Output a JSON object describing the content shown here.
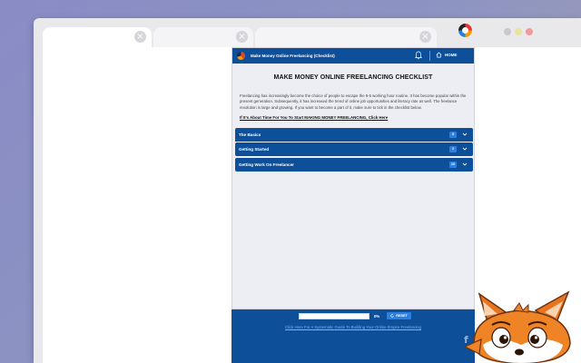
{
  "browser": {
    "tabs": [
      {
        "close_glyph": "×"
      },
      {
        "close_glyph": "×"
      },
      {
        "close_glyph": "×"
      }
    ],
    "extension_icon": "colored-ring-icon",
    "window_controls": [
      "minimize-dot",
      "maximize-dot",
      "close-dot"
    ]
  },
  "extension": {
    "header": {
      "title": "Make Money Online Freelancing (Checklist)",
      "bell_icon": "bell-icon",
      "home_label": "HOME"
    },
    "main_title": "MAKE MONEY ONLINE FREELANCING CHECKLIST",
    "intro": "Freelancing has increasingly become the choice of people to escape the 9-5 working hour routine. It has become popular within the present generation. Subsequently, it has increased the trend of online job opportunities and literacy rate as well. The freelance revolution is large and growing. If you want to become a part of it, make sure to tick in the checklist below.",
    "cta_link": "If It's About Time For You To Start MAKING MONEY FREELANCING, Click Here",
    "sections": [
      {
        "label": "The Basics",
        "count": "5"
      },
      {
        "label": "Getting Started",
        "count": "2"
      },
      {
        "label": "Getting Work On Freelancer",
        "count": "10"
      }
    ],
    "footer": {
      "progress_percent": 0,
      "progress_label": "0%",
      "reset_label": "RESET",
      "guide_link": "Click Here For A Systematic Guide To Building Your Online Empire Freelancing",
      "facebook_glyph": "f"
    },
    "colors": {
      "brand_blue": "#0e4f9a",
      "accent_blue": "#2b7fe0",
      "panel_bg": "#ededf4"
    }
  }
}
